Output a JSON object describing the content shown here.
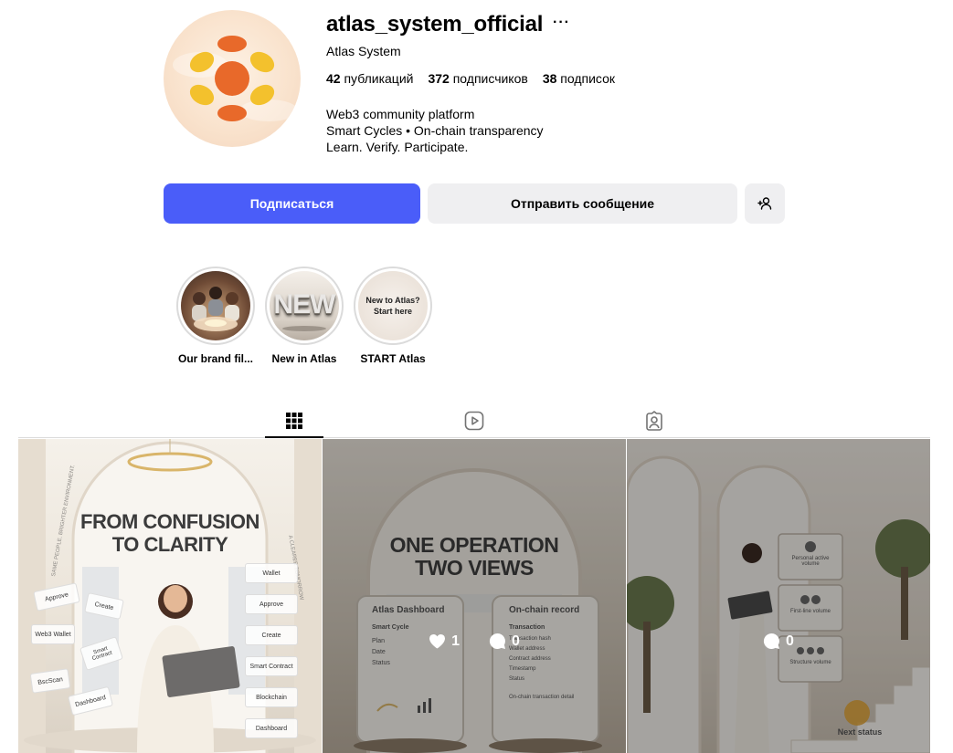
{
  "profile": {
    "username": "atlas_system_official",
    "more": "···",
    "full_name": "Atlas System",
    "stats": {
      "posts_value": "42",
      "posts_label": "публикаций",
      "followers_value": "372",
      "followers_label": "подписчиков",
      "following_value": "38",
      "following_label": "подписок"
    },
    "bio": [
      "Web3 community platform",
      "Smart Cycles • On-chain transparency",
      "Learn. Verify. Participate."
    ]
  },
  "actions": {
    "follow_label": "Подписаться",
    "message_label": "Отправить сообщение",
    "add_icon": "add-person-icon"
  },
  "highlights": [
    {
      "label": "Our brand fil..."
    },
    {
      "label": "New in Atlas",
      "art_text": "NEW"
    },
    {
      "label": "START Atlas",
      "art_text_1": "New to Atlas?",
      "art_text_2": "Start here"
    }
  ],
  "tabs": [
    "grid-icon",
    "reels-icon",
    "tagged-icon"
  ],
  "posts": [
    {
      "title_1": "FROM CONFUSION",
      "title_2": "TO CLARITY",
      "steps": [
        "Wallet",
        "Approve",
        "Create",
        "Smart Contract",
        "Blockchain",
        "Dashboard"
      ],
      "cards": [
        "Approve",
        "Create",
        "Web3 Wallet",
        "Smart Contract",
        "BscScan",
        "Dashboard"
      ],
      "side_left": "SAME PEOPLE. BRIGHTER ENVIRONMENT.",
      "side_right": "A CLEARER TOMORROW"
    },
    {
      "title_1": "ONE OPERATION",
      "title_2": "TWO VIEWS",
      "panel_left_title": "Atlas Dashboard",
      "panel_left_sub": "Smart Cycle",
      "panel_left_rows": [
        "Plan",
        "Date",
        "Status"
      ],
      "panel_right_title": "On-chain record",
      "panel_right_sub": "Transaction",
      "panel_right_rows": [
        "Transaction hash",
        "Wallet address",
        "Contract address",
        "Timestamp",
        "Status"
      ],
      "panel_right_foot": "On-chain transaction detail",
      "likes": "1",
      "comments": "0"
    },
    {
      "signs": [
        "Personal active volume",
        "First-line volume",
        "Structure volume"
      ],
      "next": "Next status",
      "comments": "0"
    }
  ],
  "colors": {
    "accent": "#4a5df9",
    "button_grey": "#efeff1",
    "logo_orange": "#e8692a",
    "logo_yellow": "#f3c12d"
  }
}
